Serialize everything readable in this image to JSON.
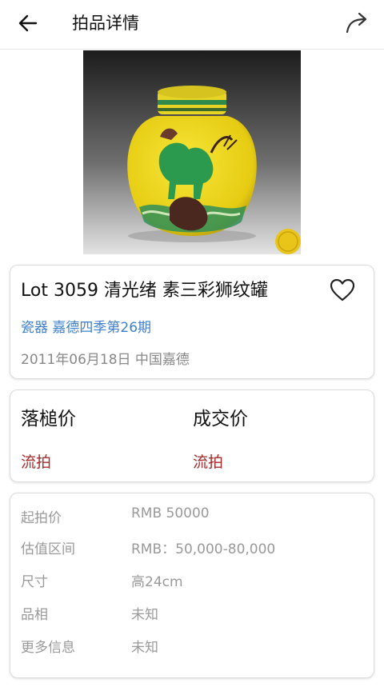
{
  "header": {
    "title": "拍品详情",
    "back_icon": "arrow-left-icon",
    "share_icon": "share-arrow-icon"
  },
  "lot": {
    "title": "Lot 3059 清光绪  素三彩狮纹罐",
    "category": "瓷器 嘉德四季第26期",
    "date_place": "2011年06月18日 中国嘉德",
    "favorite_icon": "heart-outline-icon"
  },
  "prices": {
    "hammer_label": "落槌价",
    "hammer_value": "流拍",
    "deal_label": "成交价",
    "deal_value": "流拍"
  },
  "details": [
    {
      "label": "起拍价",
      "value": "RMB 50000"
    },
    {
      "label": "估值区间",
      "value": "RMB：50,000-80,000"
    },
    {
      "label": "尺寸",
      "value": "高24cm"
    },
    {
      "label": "品相",
      "value": "未知"
    },
    {
      "label": "更多信息",
      "value": "未知"
    }
  ],
  "colors": {
    "accent_blue": "#3d7fcc",
    "status_red": "#a52a2a",
    "muted_gray": "#999999"
  }
}
